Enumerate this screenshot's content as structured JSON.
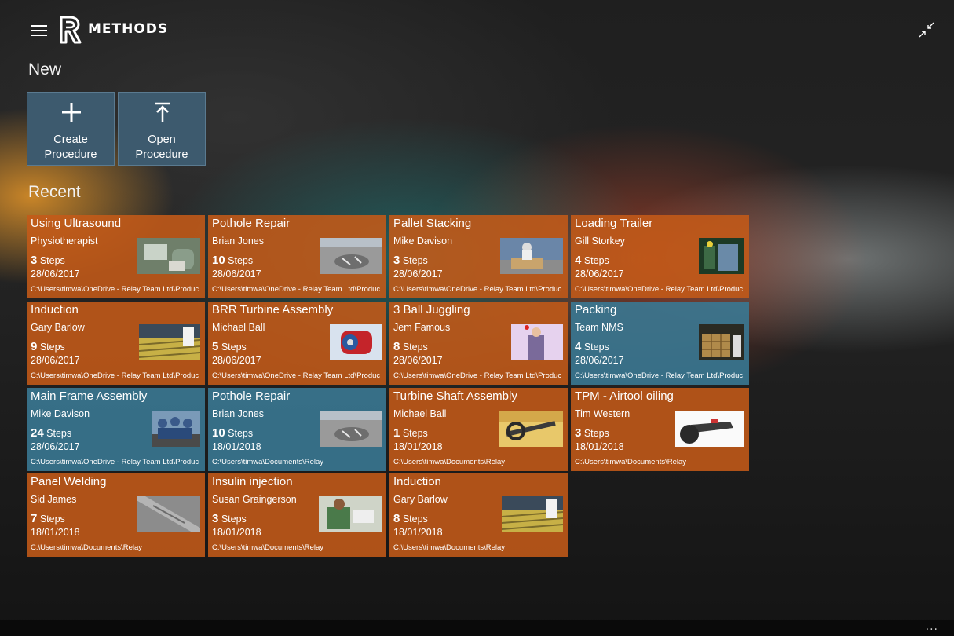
{
  "app": {
    "name": "METHODS"
  },
  "sections": {
    "new_title": "New",
    "recent_title": "Recent"
  },
  "new_buttons": {
    "create": "Create Procedure",
    "open": "Open Procedure"
  },
  "colors": {
    "orange_tile": "#c45a18",
    "blue_tile": "#3a7892",
    "new_button": "#3d5a6e"
  },
  "recent": [
    {
      "title": "Using Ultrasound",
      "author": "Physiotherapist",
      "steps": "3",
      "steps_label": "Steps",
      "date": "28/06/2017",
      "path": "C:\\Users\\timwa\\OneDrive - Relay Team Ltd\\Produc",
      "color": "orange"
    },
    {
      "title": "Pothole Repair",
      "author": "Brian Jones",
      "steps": "10",
      "steps_label": "Steps",
      "date": "28/06/2017",
      "path": "C:\\Users\\timwa\\OneDrive - Relay Team Ltd\\Produc",
      "color": "orange"
    },
    {
      "title": "Pallet Stacking",
      "author": "Mike Davison",
      "steps": "3",
      "steps_label": "Steps",
      "date": "28/06/2017",
      "path": "C:\\Users\\timwa\\OneDrive - Relay Team Ltd\\Produc",
      "color": "orange"
    },
    {
      "title": "Loading Trailer",
      "author": "Gill Storkey",
      "steps": "4",
      "steps_label": "Steps",
      "date": "28/06/2017",
      "path": "C:\\Users\\timwa\\OneDrive - Relay Team Ltd\\Produc",
      "color": "orange"
    },
    {
      "title": "Induction",
      "author": "Gary Barlow",
      "steps": "9",
      "steps_label": "Steps",
      "date": "28/06/2017",
      "path": "C:\\Users\\timwa\\OneDrive - Relay Team Ltd\\Produc",
      "color": "orange"
    },
    {
      "title": "BRR Turbine Assembly",
      "author": "Michael Ball",
      "steps": "5",
      "steps_label": "Steps",
      "date": "28/06/2017",
      "path": "C:\\Users\\timwa\\OneDrive - Relay Team Ltd\\Produc",
      "color": "orange"
    },
    {
      "title": "3 Ball Juggling",
      "author": "Jem Famous",
      "steps": "8",
      "steps_label": "Steps",
      "date": "28/06/2017",
      "path": "C:\\Users\\timwa\\OneDrive - Relay Team Ltd\\Produc",
      "color": "orange"
    },
    {
      "title": "Packing",
      "author": "Team NMS",
      "steps": "4",
      "steps_label": "Steps",
      "date": "28/06/2017",
      "path": "C:\\Users\\timwa\\OneDrive - Relay Team Ltd\\Produc",
      "color": "blue"
    },
    {
      "title": "Main Frame Assembly",
      "author": "Mike Davison",
      "steps": "24",
      "steps_label": "Steps",
      "date": "28/06/2017",
      "path": "C:\\Users\\timwa\\OneDrive - Relay Team Ltd\\Produc",
      "color": "blue"
    },
    {
      "title": "Pothole Repair",
      "author": "Brian Jones",
      "steps": "10",
      "steps_label": "Steps",
      "date": "18/01/2018",
      "path": "C:\\Users\\timwa\\Documents\\Relay",
      "color": "blue"
    },
    {
      "title": "Turbine Shaft Assembly",
      "author": "Michael Ball",
      "steps": "1",
      "steps_label": "Steps",
      "date": "18/01/2018",
      "path": "C:\\Users\\timwa\\Documents\\Relay",
      "color": "orange"
    },
    {
      "title": "TPM - Airtool oiling",
      "author": "Tim Western",
      "steps": "3",
      "steps_label": "Steps",
      "date": "18/01/2018",
      "path": "C:\\Users\\timwa\\Documents\\Relay",
      "color": "orange"
    },
    {
      "title": "Panel Welding",
      "author": "Sid James",
      "steps": "7",
      "steps_label": "Steps",
      "date": "18/01/2018",
      "path": "C:\\Users\\timwa\\Documents\\Relay",
      "color": "orange"
    },
    {
      "title": "Insulin injection",
      "author": "Susan Graingerson",
      "steps": "3",
      "steps_label": "Steps",
      "date": "18/01/2018",
      "path": "C:\\Users\\timwa\\Documents\\Relay",
      "color": "orange"
    },
    {
      "title": "Induction",
      "author": "Gary Barlow",
      "steps": "8",
      "steps_label": "Steps",
      "date": "18/01/2018",
      "path": "C:\\Users\\timwa\\Documents\\Relay",
      "color": "orange"
    }
  ],
  "bottom": {
    "more": "..."
  }
}
